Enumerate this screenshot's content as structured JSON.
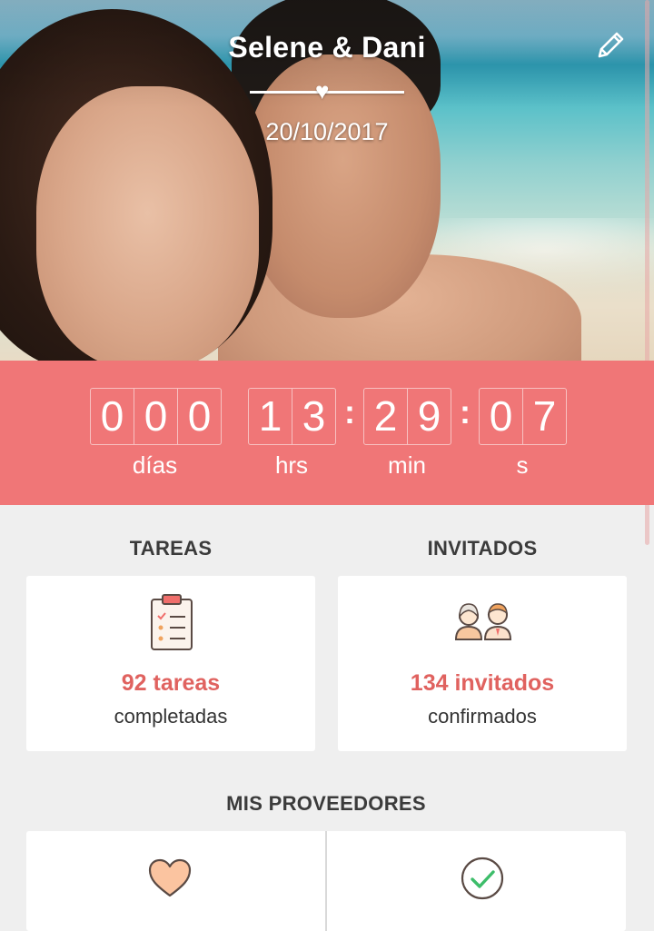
{
  "header": {
    "couple_names": "Selene & Dani",
    "wedding_date": "20/10/2017",
    "edit_icon": "pencil-icon"
  },
  "countdown": {
    "days": [
      "0",
      "0",
      "0"
    ],
    "hours": [
      "1",
      "3"
    ],
    "minutes": [
      "2",
      "9"
    ],
    "seconds": [
      "0",
      "7"
    ],
    "separator": ":",
    "labels": {
      "days": "días",
      "hours": "hrs",
      "minutes": "min",
      "seconds": "s"
    },
    "accent_color": "#f07677"
  },
  "tasks": {
    "heading": "TAREAS",
    "count_text": "92 tareas",
    "status_text": "completadas",
    "icon": "clipboard-checklist-icon"
  },
  "guests": {
    "heading": "INVITADOS",
    "count_text": "134 invitados",
    "status_text": "confirmados",
    "icon": "couple-guests-icon"
  },
  "vendors": {
    "heading": "MIS PROVEEDORES",
    "left_icon": "heart-icon",
    "right_icon": "check-circle-icon"
  },
  "colors": {
    "accent": "#e0625f",
    "background": "#efefef"
  }
}
